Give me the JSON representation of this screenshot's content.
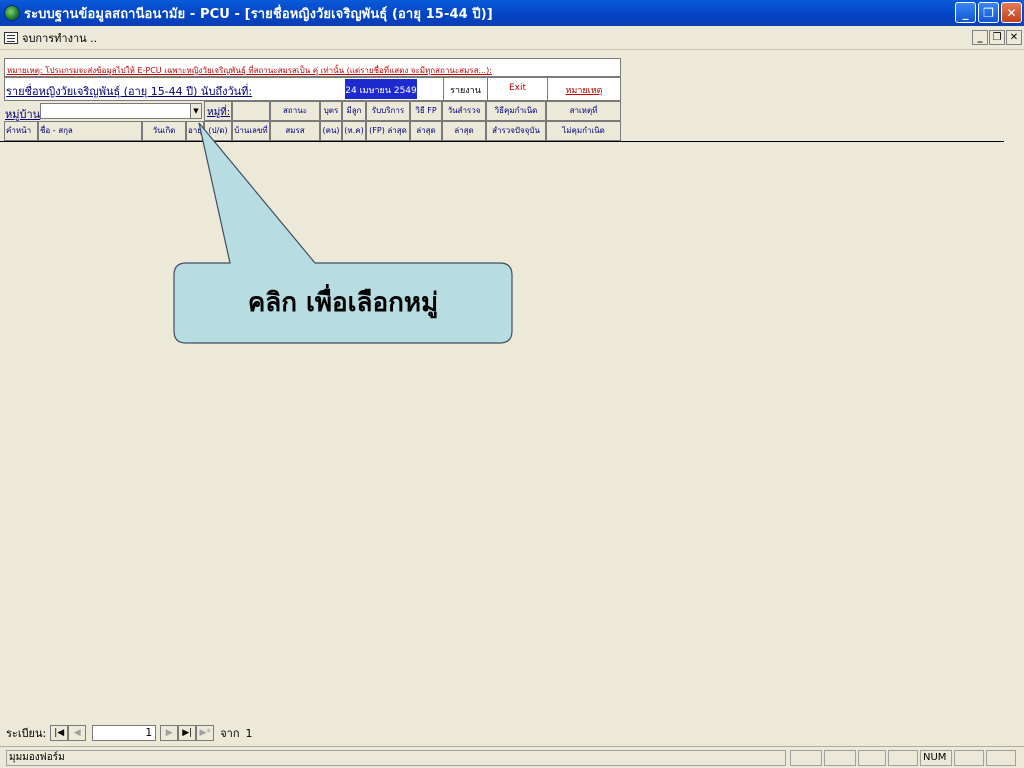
{
  "window": {
    "title": "ระบบฐานข้อมูลสถานีอนามัย - PCU - [รายชื่อหญิงวัยเจริญพันธุ์ (อายุ 15-44 ปี)]",
    "minimize": "_",
    "restore": "❐",
    "close": "✕"
  },
  "menubar": {
    "item": "จบการทำงาน .."
  },
  "form": {
    "notice": "หมายเหตุ: โปรแกรมจะส่งข้อมูลไปให้ E-PCU เฉพาะหญิงวัยเจริญพันธุ์ ที่สถานะสมรสเป็น คู่ เท่านั้น (แต่รายชื่อที่แสดง จะมีทุกสถานะสมรส...):",
    "header_label": "รายชื่อหญิงวัยเจริญพันธุ์ (อายุ 15-44 ปี) นับถึงวันที่:",
    "date": "24 เมษายน 2549",
    "report_button": "รายงาน",
    "exit_button": "Exit",
    "note_button": "หมายเหตุ",
    "village_label": "หมู่บ้าน",
    "village_value": "",
    "moo_label": "หมู่ที่:",
    "columns_top": {
      "marital": "สถานะ",
      "children": "บุตร",
      "pregnant": "มีลูก",
      "service": "รับบริการ",
      "fp": "วิธี FP",
      "date_visit": "วันสำรวจ",
      "contraception": "วิธีคุมกำเนิด",
      "reason": "สาเหตุที่"
    },
    "columns_bottom": {
      "prefix": "คำหน้า",
      "name": "ชื่อ - สกุล",
      "birthdate": "วันเกิด",
      "age": "อายุ",
      "age_unit": "(ป/ด)",
      "house": "บ้านเลขที่",
      "marital": "สมรส",
      "children": "(คน)",
      "pregnant": "(ห.ค)",
      "service": "(FP) ล่าสุด",
      "fp": "ล่าสุด",
      "date_visit": "ล่าสุด",
      "contraception": "สำรวจปัจจุบัน",
      "reason": "ไม่คุมกำเนิด"
    }
  },
  "callout": {
    "text": "คลิก เพื่อเลือกหมู่"
  },
  "navigator": {
    "label": "ระเบียน:",
    "current": "1",
    "of_label": "จาก",
    "total": "1"
  },
  "statusbar": {
    "text": "มุมมองฟอร์ม",
    "num": "NUM"
  }
}
